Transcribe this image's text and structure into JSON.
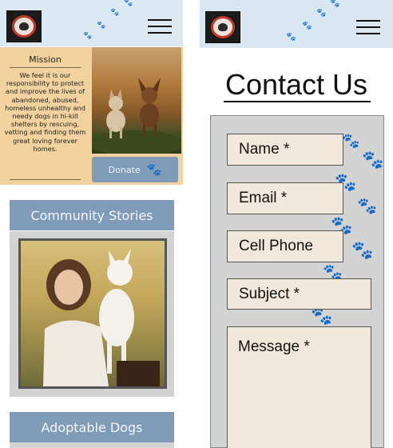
{
  "left": {
    "mission": {
      "title": "Mission",
      "body": "We feel it is our responsibility to protect and improve the lives of abandoned, abused, homeless unhealthy and needy dogs in hi-kill shelters by rescuing, vetting and finding them great loving forever homes.",
      "donate_label": "Donate"
    },
    "community_title": "Community Stories",
    "adoptable_title": "Adoptable Dogs"
  },
  "right": {
    "contact_title": "Contact Us",
    "form": {
      "name_placeholder": "Name *",
      "email_placeholder": "Email *",
      "phone_placeholder": "Cell Phone",
      "subject_placeholder": "Subject *",
      "message_placeholder": "Message *"
    }
  },
  "colors": {
    "header_bg": "#dce9f3",
    "mission_bg": "#f2d39f",
    "accent_blue": "#7f9bb7",
    "card_gray": "#d3d3d3",
    "field_bg": "#f1e8db"
  },
  "icons": [
    "logo-icon",
    "menu-icon",
    "paw-icon"
  ]
}
